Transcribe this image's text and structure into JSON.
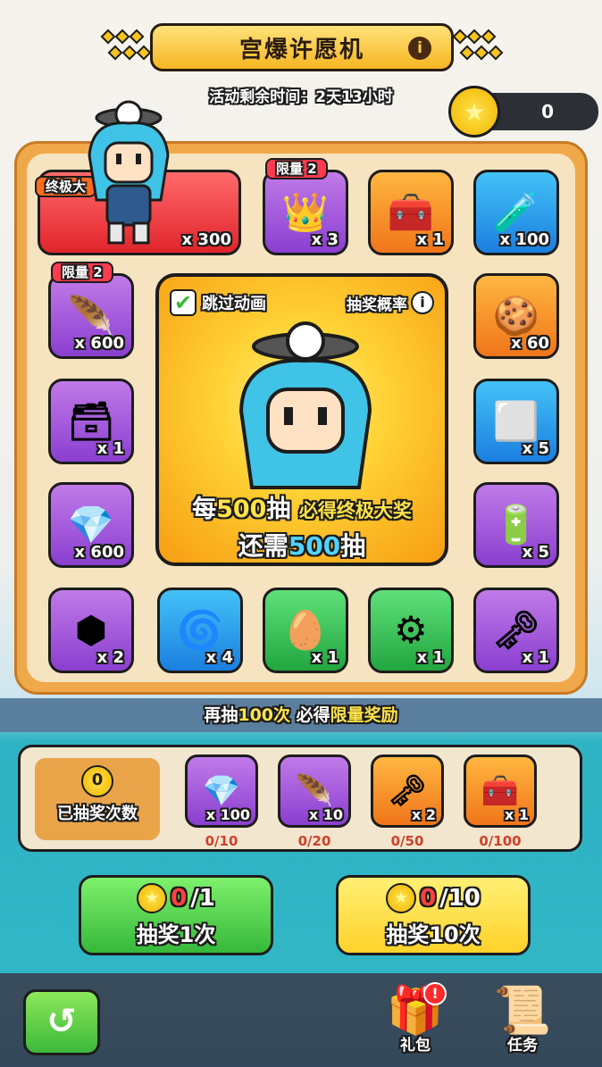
{
  "header": {
    "title": "宫爆许愿机",
    "info_icon": "info-icon",
    "timer_text": "活动剩余时间：2天13小时"
  },
  "currency": {
    "icon": "star-coin-icon",
    "amount": "0"
  },
  "board": {
    "grand_prize": {
      "label": "终极大",
      "qty": "x 300"
    },
    "tiles": [
      {
        "icon": "crown-chest",
        "glyph": "👑",
        "qty": "x 3",
        "limit": "限量 2"
      },
      {
        "icon": "golden-chest",
        "glyph": "🧰",
        "qty": "x 1"
      },
      {
        "icon": "potion-bottle",
        "glyph": "🧪",
        "qty": "x 100"
      },
      {
        "icon": "purple-feather",
        "glyph": "🪶",
        "qty": "x 600",
        "limit": "限量 2"
      },
      {
        "icon": "bread-token",
        "glyph": "🍪",
        "qty": "x 60"
      },
      {
        "icon": "silver-chest",
        "glyph": "🗃",
        "qty": "x 1"
      },
      {
        "icon": "silver-ingot",
        "glyph": "⬜",
        "qty": "x 5"
      },
      {
        "icon": "gem-pile",
        "glyph": "💎",
        "qty": "x 600"
      },
      {
        "icon": "battery-capsule",
        "glyph": "🔋",
        "qty": "x 5"
      },
      {
        "icon": "purple-hex-stone",
        "glyph": "⬢",
        "qty": "x 2"
      },
      {
        "icon": "gold-swirl-coin",
        "glyph": "🌀",
        "qty": "x 4"
      },
      {
        "icon": "green-egg",
        "glyph": "🥚",
        "qty": "x 1"
      },
      {
        "icon": "gear-chip",
        "glyph": "⚙",
        "qty": "x 1"
      },
      {
        "icon": "heart-key",
        "glyph": "🗝",
        "qty": "x 1"
      }
    ],
    "center": {
      "skip_label": "跳过动画",
      "prob_label": "抽奖概率",
      "line1_a": "每",
      "line1_num": "500",
      "line1_b": "抽",
      "line1_c": "必得终极大奖",
      "line2_a": "还需",
      "line2_num": "500",
      "line2_b": "抽"
    }
  },
  "progress_banner": {
    "a": "再抽",
    "num": "100次",
    "b": " 必得",
    "c": "限量奖励"
  },
  "rewards_track": {
    "counter_label": "已抽奖次数",
    "counter_value": "0",
    "items": [
      {
        "icon": "diamond",
        "glyph": "💎",
        "qty": "x 100",
        "progress": "0/10"
      },
      {
        "icon": "purple-feather",
        "glyph": "🪶",
        "qty": "x 10",
        "progress": "0/20"
      },
      {
        "icon": "heart-key",
        "glyph": "🗝",
        "qty": "x 2",
        "progress": "0/50"
      },
      {
        "icon": "green-chest",
        "glyph": "🧰",
        "qty": "x 1",
        "progress": "0/100"
      }
    ]
  },
  "draw_buttons": [
    {
      "have": "0",
      "cost": "/1",
      "label": "抽奖1次"
    },
    {
      "have": "0",
      "cost": "/10",
      "label": "抽奖10次"
    }
  ],
  "bottom_nav": {
    "back_icon": "swirl-back-icon",
    "gift_label": "礼包",
    "gift_badge": "!",
    "task_label": "任务"
  }
}
